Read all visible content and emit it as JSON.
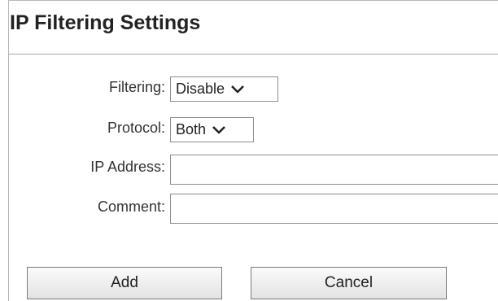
{
  "page": {
    "title": "IP Filtering Settings"
  },
  "form": {
    "filtering": {
      "label": "Filtering:",
      "value": "Disable",
      "icon": "chevron-down-icon"
    },
    "protocol": {
      "label": "Protocol:",
      "value": "Both",
      "icon": "chevron-down-icon"
    },
    "ip_address": {
      "label": "IP Address:",
      "value": ""
    },
    "comment": {
      "label": "Comment:",
      "value": ""
    }
  },
  "buttons": {
    "add_label": "Add",
    "cancel_label": "Cancel"
  }
}
